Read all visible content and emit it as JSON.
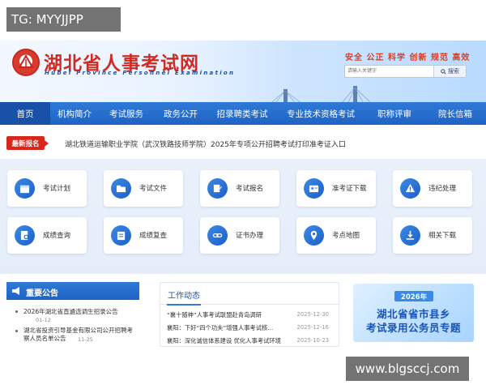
{
  "watermark_top": "TG: MYYJJPP",
  "watermark_bottom": "www.blgsccj.com",
  "header": {
    "title": "湖北省人事考试网",
    "subtitle": "Hubei Province Personnel Examination",
    "slogan": "安全 公正 科学 创新 规范 高效",
    "search_placeholder": "请输入关键字",
    "search_button": "搜索"
  },
  "nav": [
    {
      "label": "首页",
      "active": true
    },
    {
      "label": "机构简介"
    },
    {
      "label": "考试服务"
    },
    {
      "label": "政务公开"
    },
    {
      "label": "招录聘类考试"
    },
    {
      "label": "专业技术资格考试"
    },
    {
      "label": "职称评审"
    },
    {
      "label": "院长信箱"
    }
  ],
  "notice": {
    "badge": "最新报名",
    "text": "湖北铁道运输职业学院（武汉铁路技师学院）2025年专项公开招聘考试打印准考证入口"
  },
  "services": [
    {
      "label": "考试计划",
      "icon": "calendar-icon"
    },
    {
      "label": "考试文件",
      "icon": "folder-icon"
    },
    {
      "label": "考试报名",
      "icon": "edit-icon"
    },
    {
      "label": "准考证下载",
      "icon": "id-card-icon"
    },
    {
      "label": "违纪处理",
      "icon": "warning-icon"
    },
    {
      "label": "成绩查询",
      "icon": "document-search-icon"
    },
    {
      "label": "成绩复查",
      "icon": "clipboard-icon"
    },
    {
      "label": "证书办理",
      "icon": "link-icon"
    },
    {
      "label": "考点地图",
      "icon": "map-icon"
    },
    {
      "label": "相关下载",
      "icon": "download-icon"
    }
  ],
  "announcements": {
    "title": "重要公告",
    "items": [
      {
        "text": "2026年湖北省直遴选调生招录公告",
        "date": "01-12"
      },
      {
        "text": "湖北省投资引导基金有限公司公开招聘考察人员名单公告",
        "date": "11-25"
      }
    ]
  },
  "work_news": {
    "title": "工作动态",
    "items": [
      {
        "text": "“襄十随神”人事考试联盟赴青岛调研",
        "date": "2025-12-30"
      },
      {
        "text": "襄阳：下好“四个功夫”增强人事考试核...",
        "date": "2025-12-16"
      },
      {
        "text": "襄阳：深化诚信体系建设 优化人事考试环境",
        "date": "2025-10-23"
      }
    ]
  },
  "promo": {
    "year": "2026年",
    "line1": "湖北省省市县乡",
    "line2": "考试录用公务员专题"
  },
  "colors": {
    "brand_red": "#d12a22",
    "nav_blue": "#1f63c4",
    "accent_blue": "#2f7ad6"
  }
}
